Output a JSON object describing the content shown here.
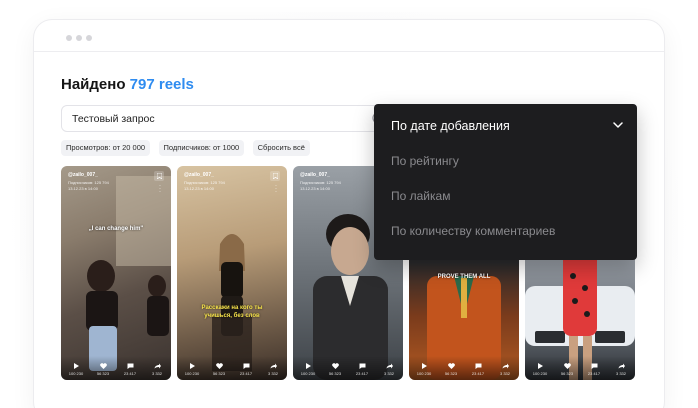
{
  "heading": {
    "prefix": "Найдено",
    "count": "797 reels"
  },
  "search": {
    "value": "Тестовый запрос"
  },
  "filters": [
    {
      "label": "Просмотров: от 20 000"
    },
    {
      "label": "Подписчиков: от 1000"
    },
    {
      "label": "Сбросить всё"
    }
  ],
  "sort_dropdown": {
    "selected": "По дате добавления",
    "options": [
      "По рейтингу",
      "По лайкам",
      "По количеству комментариев"
    ]
  },
  "cards": [
    {
      "handle": "@zailo_007_",
      "meta1": "Подписчиков: 125 794",
      "meta2": "13.12.23 в 14:00",
      "caption": "„I can change him\"",
      "stats": [
        "100 230",
        "56 323",
        "23 417",
        "3 332"
      ]
    },
    {
      "handle": "@zailo_007_",
      "meta1": "Подписчиков: 125 794",
      "meta2": "13.12.23 в 14:00",
      "caption": "Расскажи на кого ты учишься, без слов",
      "stats": [
        "100 230",
        "56 323",
        "23 417",
        "3 332"
      ]
    },
    {
      "handle": "@zailo_007_",
      "meta1": "Подписчиков: 125 794",
      "meta2": "13.12.23 в 14:00",
      "caption": "",
      "stats": [
        "100 230",
        "56 323",
        "23 417",
        "3 332"
      ]
    },
    {
      "handle": "",
      "meta1": "",
      "meta2": "",
      "caption": "PROVE THEM ALL",
      "stats": [
        "100 230",
        "56 323",
        "23 417",
        "3 332"
      ]
    },
    {
      "handle": "",
      "meta1": "",
      "meta2": "",
      "caption": "",
      "stats": [
        "100 230",
        "56 323",
        "23 417",
        "3 332"
      ]
    }
  ],
  "colors": {
    "accent": "#2f8cf0",
    "dropdown_bg": "#1d1d1f"
  }
}
